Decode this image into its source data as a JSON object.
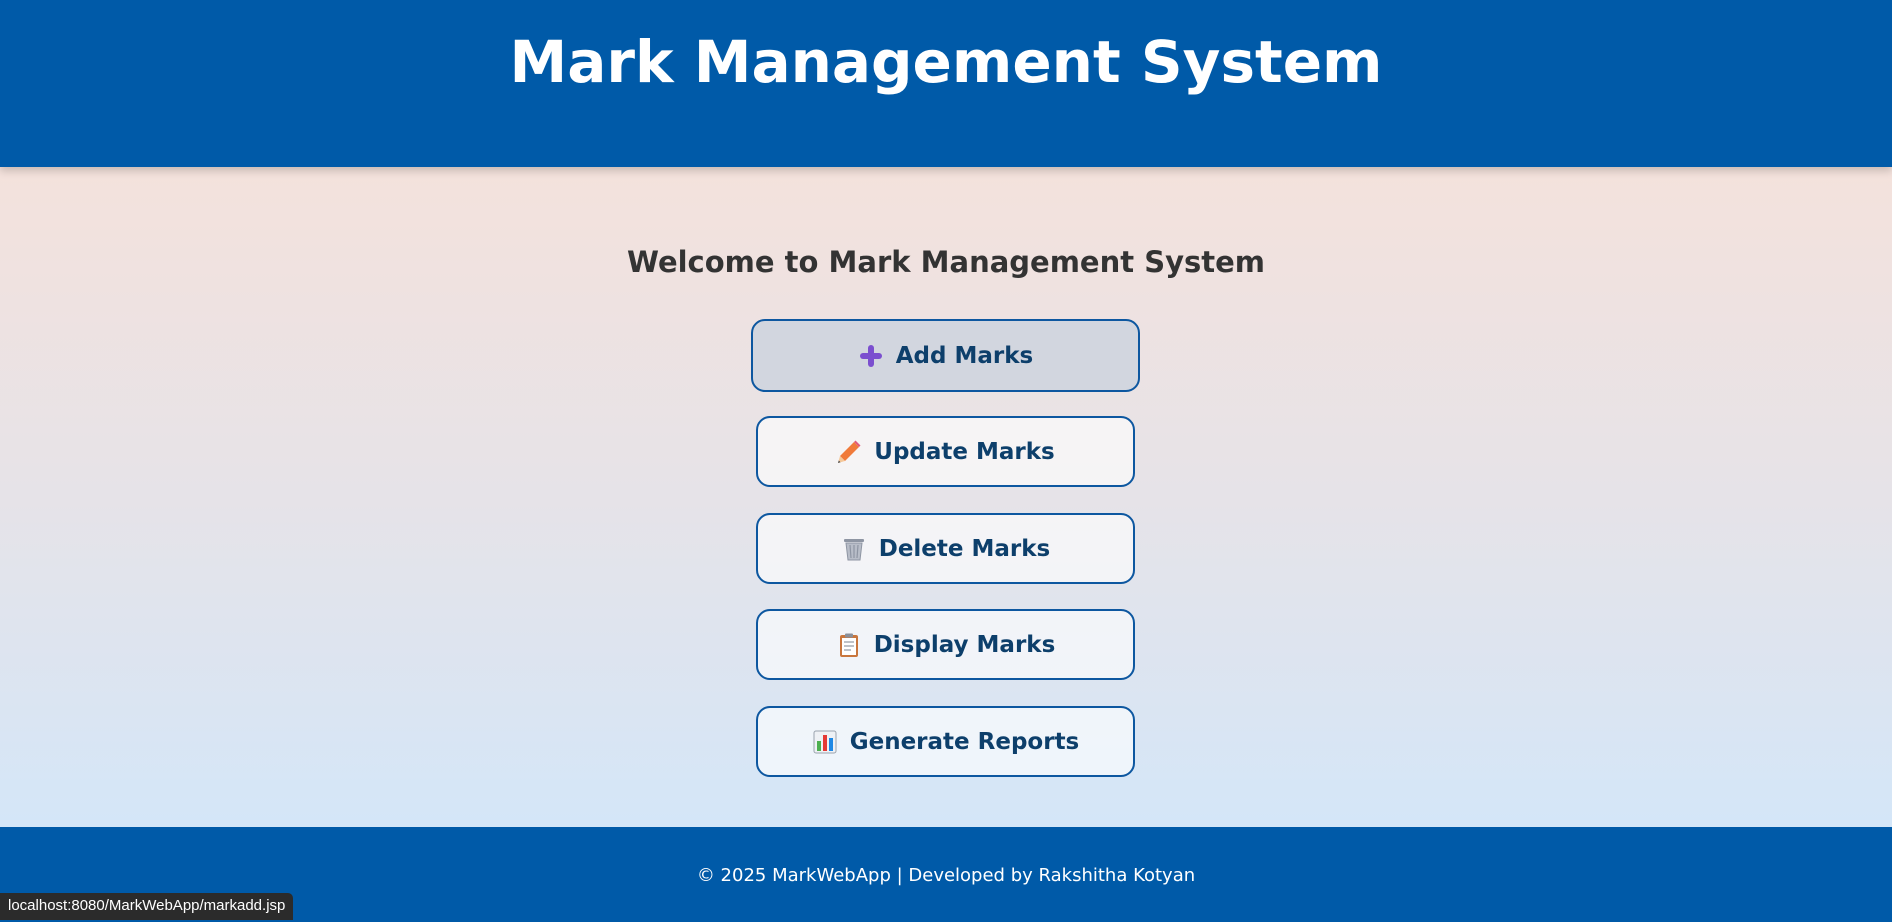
{
  "header": {
    "title": "Mark Management System"
  },
  "main": {
    "welcome": "Welcome to Mark Management System",
    "buttons": [
      {
        "label": "Add Marks",
        "icon": "plus-icon"
      },
      {
        "label": "Update Marks",
        "icon": "pencil-icon"
      },
      {
        "label": "Delete Marks",
        "icon": "trash-icon"
      },
      {
        "label": "Display Marks",
        "icon": "clipboard-icon"
      },
      {
        "label": "Generate Reports",
        "icon": "bar-chart-icon"
      }
    ]
  },
  "footer": {
    "text": "© 2025 MarkWebApp | Developed by Rakshitha Kotyan"
  },
  "status_bar": {
    "url": "localhost:8080/MarkWebApp/markadd.jsp"
  },
  "colors": {
    "brand": "#005aa8",
    "button_border": "#0d57a0",
    "button_text": "#0d3f6b"
  }
}
